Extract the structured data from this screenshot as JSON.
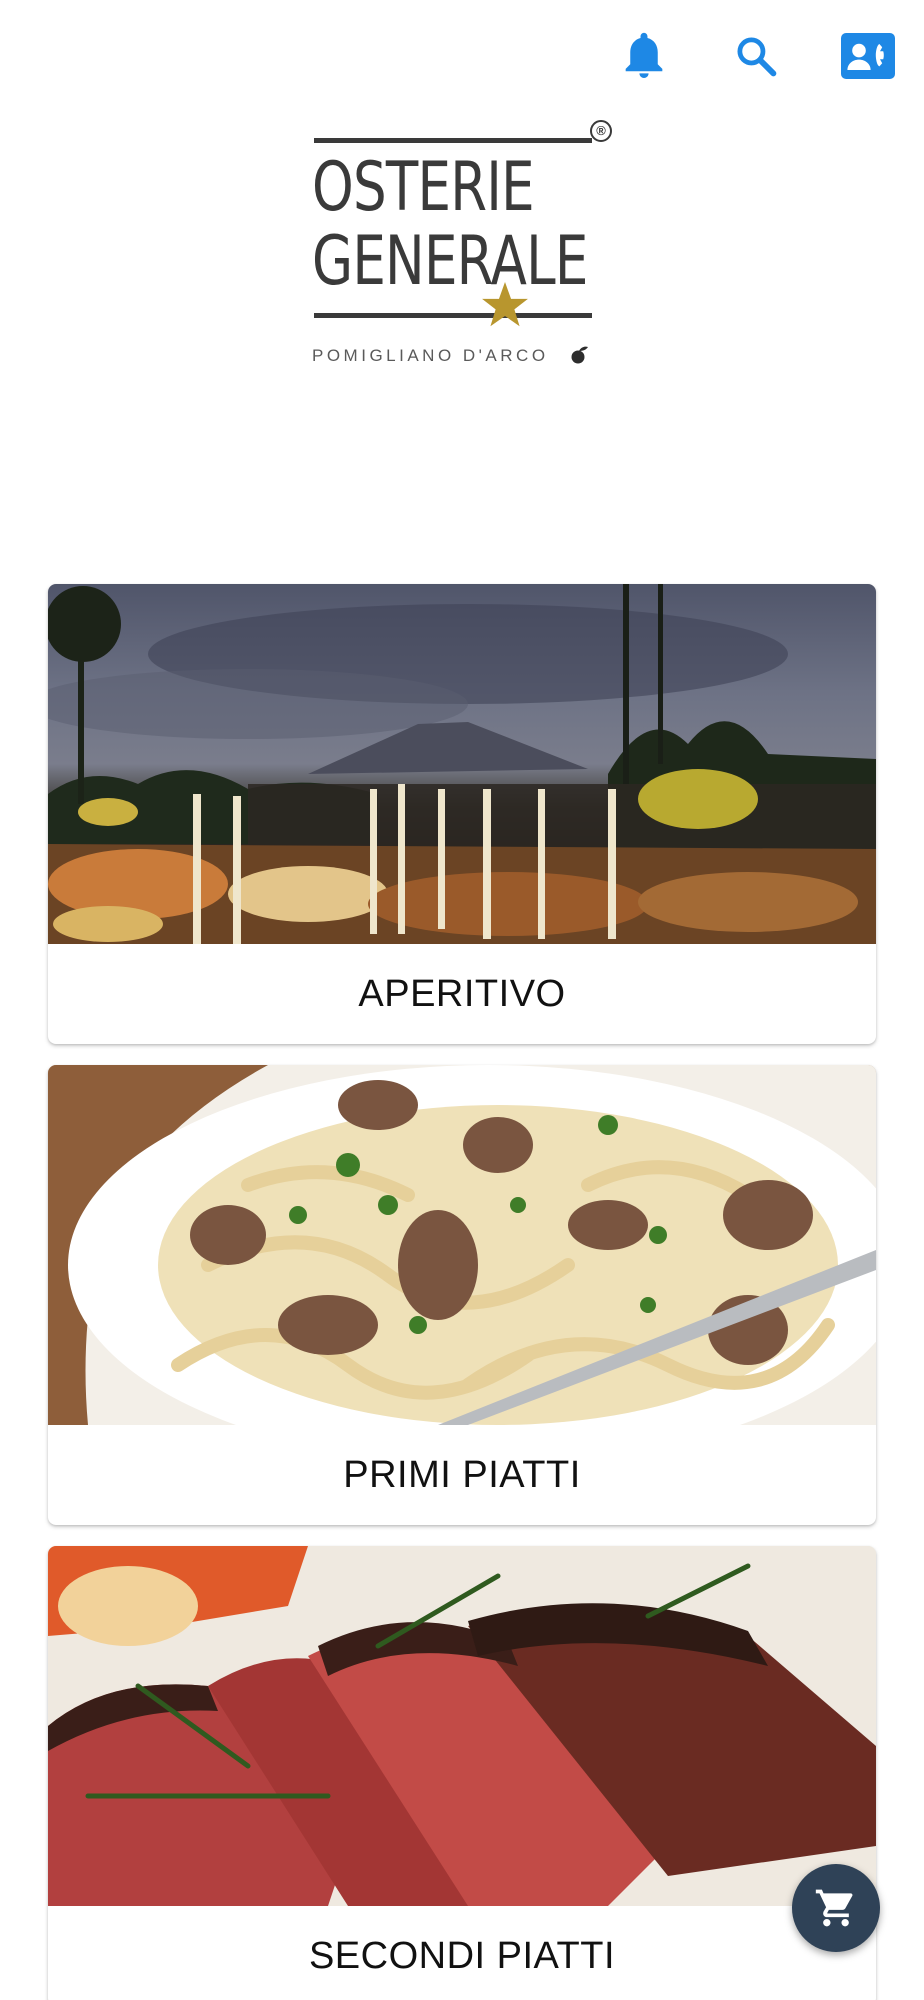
{
  "header": {
    "icons": [
      "bell-icon",
      "search-icon",
      "contact-card-icon"
    ],
    "accent_color": "#1e88e5"
  },
  "logo": {
    "line1": "OSTERIE",
    "line2": "GENERALE",
    "registered_mark": "®",
    "location": "POMIGLIANO D'ARCO",
    "star_color": "#b8962e",
    "text_color": "#3a3a3a"
  },
  "menu": {
    "categories": [
      {
        "label": "APERITIVO",
        "image": "aperitivo-photo"
      },
      {
        "label": "PRIMI PIATTI",
        "image": "pasta-photo"
      },
      {
        "label": "SECONDI PIATTI",
        "image": "steak-photo"
      }
    ]
  },
  "cart": {
    "icon": "cart-icon",
    "fab_color": "#2f4257"
  }
}
